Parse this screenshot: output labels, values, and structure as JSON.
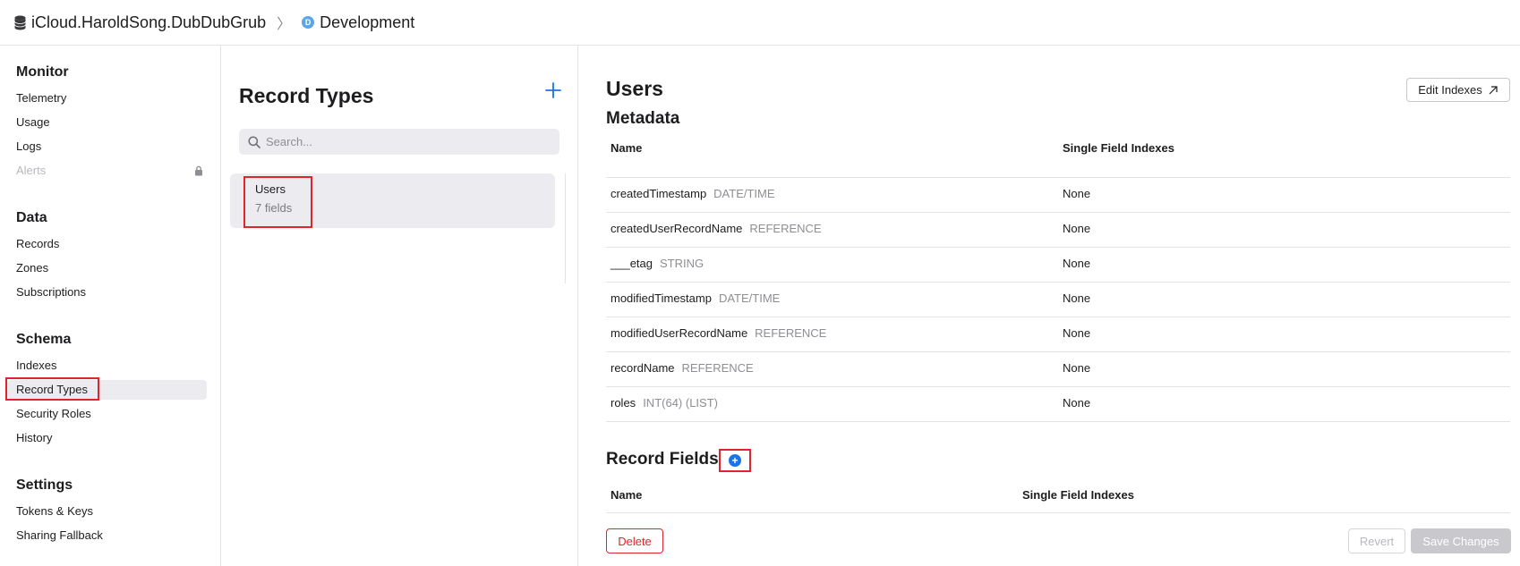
{
  "header": {
    "container": "iCloud.HaroldSong.DubDubGrub",
    "chevron": "〉",
    "env_badge": "D",
    "environment": "Development"
  },
  "sidebar": {
    "monitor": {
      "title": "Monitor",
      "items": [
        "Telemetry",
        "Usage",
        "Logs",
        "Alerts"
      ]
    },
    "data": {
      "title": "Data",
      "items": [
        "Records",
        "Zones",
        "Subscriptions"
      ]
    },
    "schema": {
      "title": "Schema",
      "items": [
        "Indexes",
        "Record Types",
        "Security Roles",
        "History"
      ]
    },
    "settings": {
      "title": "Settings",
      "items": [
        "Tokens & Keys",
        "Sharing Fallback"
      ]
    },
    "selected": "Record Types",
    "locked_item": "Alerts"
  },
  "record_types": {
    "title": "Record Types",
    "search_placeholder": "Search...",
    "items": [
      {
        "name": "Users",
        "fields": "7 fields"
      }
    ]
  },
  "detail": {
    "title": "Users",
    "edit_indexes_label": "Edit Indexes",
    "metadata": {
      "title": "Metadata",
      "col_name": "Name",
      "col_indexes": "Single Field Indexes",
      "rows": [
        {
          "name": "createdTimestamp",
          "type": "DATE/TIME",
          "indexes": "None"
        },
        {
          "name": "createdUserRecordName",
          "type": "REFERENCE",
          "indexes": "None"
        },
        {
          "name": "___etag",
          "type": "STRING",
          "indexes": "None"
        },
        {
          "name": "modifiedTimestamp",
          "type": "DATE/TIME",
          "indexes": "None"
        },
        {
          "name": "modifiedUserRecordName",
          "type": "REFERENCE",
          "indexes": "None"
        },
        {
          "name": "recordName",
          "type": "REFERENCE",
          "indexes": "None"
        },
        {
          "name": "roles",
          "type": "INT(64) (LIST)",
          "indexes": "None"
        }
      ]
    },
    "record_fields": {
      "title": "Record Fields",
      "col_name": "Name",
      "col_indexes": "Single Field Indexes"
    },
    "delete_label": "Delete",
    "revert_label": "Revert",
    "save_label": "Save Changes"
  },
  "colors": {
    "accent": "#1a73e8",
    "highlight_box": "#e0242c",
    "env_badge": "#5aa6e8"
  }
}
